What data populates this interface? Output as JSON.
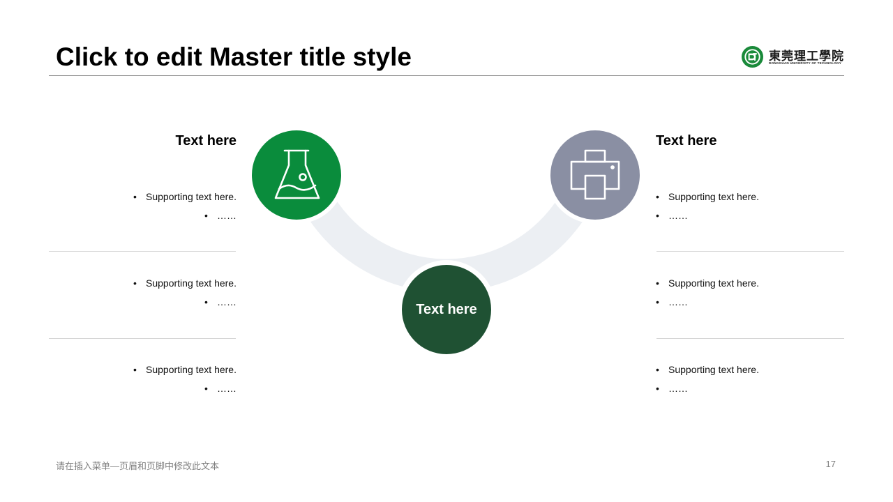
{
  "slide": {
    "title": "Click to edit Master title style",
    "footer": "请在插入菜单—页眉和页脚中修改此文本",
    "page_number": "17"
  },
  "logo": {
    "name_cn": "東莞理工學院",
    "name_en": "DONGGUAN UNIVERSITY OF TECHNOLOGY",
    "icon": "university-emblem-icon"
  },
  "center": {
    "label": "Text here",
    "color": "#1f5133"
  },
  "left": {
    "heading": "Text here",
    "icon": "flask-icon",
    "color": "#0a8c3c",
    "groups": [
      {
        "items": [
          "Supporting text here.",
          "……"
        ]
      },
      {
        "items": [
          "Supporting text here.",
          "……"
        ]
      },
      {
        "items": [
          "Supporting text here.",
          "……"
        ]
      }
    ]
  },
  "right": {
    "heading": "Text here",
    "icon": "printer-icon",
    "color": "#8a8fa3",
    "groups": [
      {
        "items": [
          "Supporting text here.",
          "……"
        ]
      },
      {
        "items": [
          "Supporting text here.",
          "……"
        ]
      },
      {
        "items": [
          "Supporting text here.",
          "……"
        ]
      }
    ]
  },
  "bullet_char": "•",
  "arc_color": "#eceff3"
}
